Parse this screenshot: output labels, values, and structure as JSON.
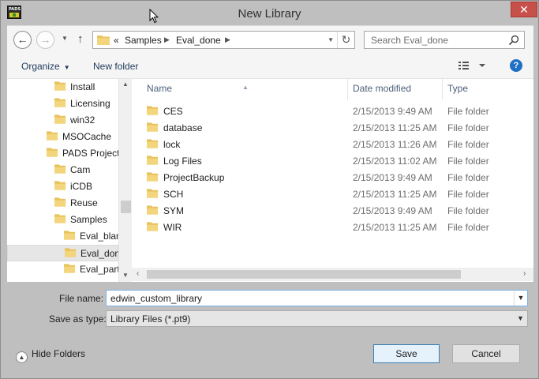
{
  "window": {
    "title": "New Library",
    "close_label": "✕",
    "app_icon_text": "PADS"
  },
  "nav": {
    "back_glyph": "←",
    "forward_glyph": "→",
    "up_glyph": "↑",
    "refresh_glyph": "↻",
    "breadcrumb": [
      "«",
      "Samples",
      "Eval_done"
    ],
    "search_placeholder": "Search Eval_done"
  },
  "commands": {
    "organize": "Organize",
    "new_folder": "New folder"
  },
  "tree": {
    "items": [
      {
        "label": "Install",
        "indent": 2
      },
      {
        "label": "Licensing",
        "indent": 2
      },
      {
        "label": "win32",
        "indent": 2
      },
      {
        "label": "MSOCache",
        "indent": 1
      },
      {
        "label": "PADS Project",
        "indent": 1
      },
      {
        "label": "Cam",
        "indent": 2
      },
      {
        "label": "iCDB",
        "indent": 2
      },
      {
        "label": "Reuse",
        "indent": 2
      },
      {
        "label": "Samples",
        "indent": 2
      },
      {
        "label": "Eval_blan",
        "indent": 3
      },
      {
        "label": "Eval_done",
        "indent": 3,
        "selected": true
      },
      {
        "label": "Eval_parti",
        "indent": 3
      }
    ]
  },
  "columns": {
    "name": "Name",
    "date": "Date modified",
    "type": "Type"
  },
  "files": [
    {
      "name": "CES",
      "date": "2/15/2013 9:49 AM",
      "type": "File folder"
    },
    {
      "name": "database",
      "date": "2/15/2013 11:25 AM",
      "type": "File folder"
    },
    {
      "name": "lock",
      "date": "2/15/2013 11:26 AM",
      "type": "File folder"
    },
    {
      "name": "Log Files",
      "date": "2/15/2013 11:02 AM",
      "type": "File folder"
    },
    {
      "name": "ProjectBackup",
      "date": "2/15/2013 9:49 AM",
      "type": "File folder"
    },
    {
      "name": "SCH",
      "date": "2/15/2013 11:25 AM",
      "type": "File folder"
    },
    {
      "name": "SYM",
      "date": "2/15/2013 9:49 AM",
      "type": "File folder"
    },
    {
      "name": "WIR",
      "date": "2/15/2013 11:25 AM",
      "type": "File folder"
    }
  ],
  "form": {
    "file_name_label": "File name:",
    "file_name_value": "edwin_custom_library",
    "save_type_label": "Save as type:",
    "save_type_value": "Library Files (*.pt9)"
  },
  "footer": {
    "hide_folders": "Hide Folders",
    "save": "Save",
    "cancel": "Cancel"
  },
  "colors": {
    "folder": "#e8c25a",
    "accent": "#3c7fb1",
    "close": "#c7504a"
  }
}
